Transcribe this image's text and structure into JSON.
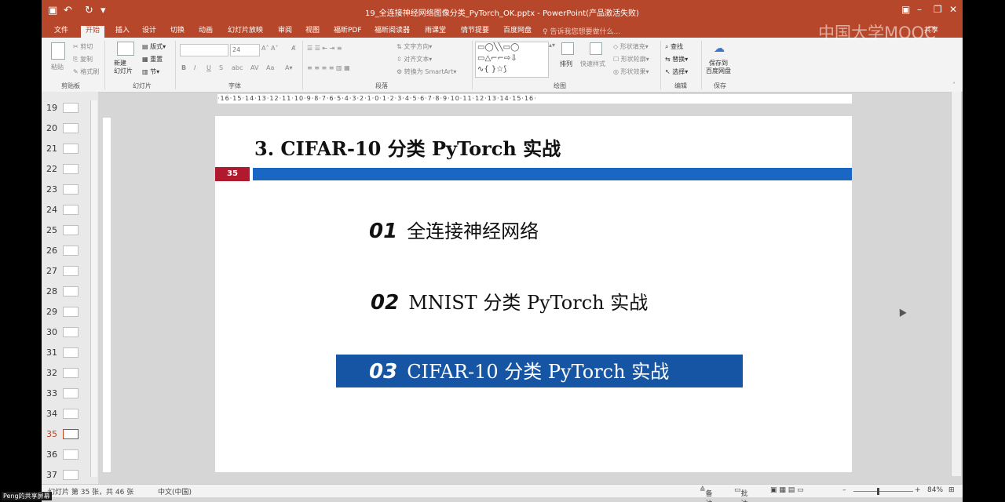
{
  "titlebar": {
    "title": "19_全连接神经网络图像分类_PyTorch_OK.pptx - PowerPoint(产品激活失败)",
    "save_icon": "save-icon",
    "undo_icon": "undo-icon",
    "redo_icon": "redo-icon"
  },
  "tabs": [
    "文件",
    "开始",
    "插入",
    "设计",
    "切换",
    "动画",
    "幻灯片放映",
    "审阅",
    "视图",
    "福昕PDF",
    "福昕阅读器",
    "雨课堂",
    "情节提要",
    "百度网盘"
  ],
  "active_tab": "开始",
  "tell_me": "告诉我您想要做什么...",
  "share": "共享",
  "ribbon": {
    "clipboard": {
      "label": "剪贴板",
      "paste": "粘贴",
      "cut": "剪切",
      "copy": "复制",
      "format_painter": "格式刷"
    },
    "slides": {
      "label": "幻灯片",
      "new_slide": "新建\n幻灯片",
      "layout": "版式",
      "reset": "重置",
      "section": "节"
    },
    "font": {
      "label": "字体",
      "size": "24"
    },
    "paragraph": {
      "label": "段落",
      "text_direction": "文字方向",
      "align_text": "对齐文本",
      "smartart": "转换为 SmartArt"
    },
    "drawing": {
      "label": "绘图",
      "arrange": "排列",
      "quick_styles": "快速样式",
      "shape_fill": "形状填充",
      "shape_outline": "形状轮廓",
      "shape_effects": "形状效果"
    },
    "editing": {
      "label": "编辑",
      "find": "查找",
      "replace": "替换",
      "select": "选择"
    },
    "save": {
      "label": "保存",
      "save_to": "保存到\n百度网盘"
    }
  },
  "thumbnails": [
    "19",
    "20",
    "21",
    "22",
    "23",
    "24",
    "25",
    "26",
    "27",
    "28",
    "29",
    "30",
    "31",
    "32",
    "33",
    "34",
    "35",
    "36",
    "37"
  ],
  "selected_slide": "35",
  "ruler_top": "·16·15·14·13·12·11·10·9·8·7·6·5·4·3·2·1·0·1·2·3·4·5·6·7·8·9·10·11·12·13·14·15·16·",
  "slide": {
    "title": "3.  CIFAR-10 分类 PyTorch 实战",
    "page_number": "35",
    "items": [
      {
        "num": "01",
        "text": "全连接神经网络"
      },
      {
        "num": "02",
        "text": "MNIST 分类 PyTorch 实战"
      },
      {
        "num": "03",
        "text": "CIFAR-10 分类 PyTorch 实战"
      }
    ],
    "colors": {
      "bar": "#1a66c3",
      "number_box": "#b01a2e",
      "highlight": "#1655a4"
    }
  },
  "statusbar": {
    "slide_info": "幻灯片 第 35 张，共 46 张",
    "language": "中文(中国)",
    "notes": "备注",
    "comments": "批注",
    "zoom": "84%"
  },
  "watermark": "中国大学MOOC",
  "screen_share_label": "Peng的共享屏幕"
}
